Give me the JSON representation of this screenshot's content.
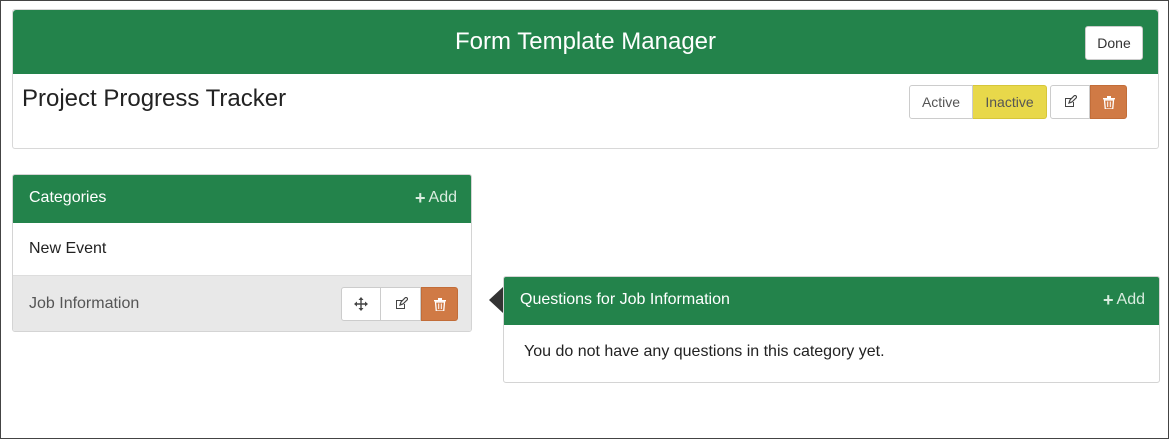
{
  "header": {
    "title": "Form Template Manager",
    "done_label": "Done"
  },
  "form": {
    "name": "Project Progress Tracker",
    "status_active_label": "Active",
    "status_inactive_label": "Inactive",
    "selected_status": "Inactive"
  },
  "categories": {
    "title": "Categories",
    "add_label": "Add",
    "items": [
      {
        "label": "New Event",
        "selected": false
      },
      {
        "label": "Job Information",
        "selected": true
      }
    ]
  },
  "questions": {
    "title": "Questions for Job Information",
    "add_label": "Add",
    "empty_message": "You do not have any questions in this category yet."
  },
  "colors": {
    "brand_green": "#23834b",
    "inactive_yellow": "#e8d84a",
    "danger_orange": "#d07a45"
  },
  "icons": [
    "edit-icon",
    "trash-icon",
    "move-icon",
    "plus-icon"
  ]
}
